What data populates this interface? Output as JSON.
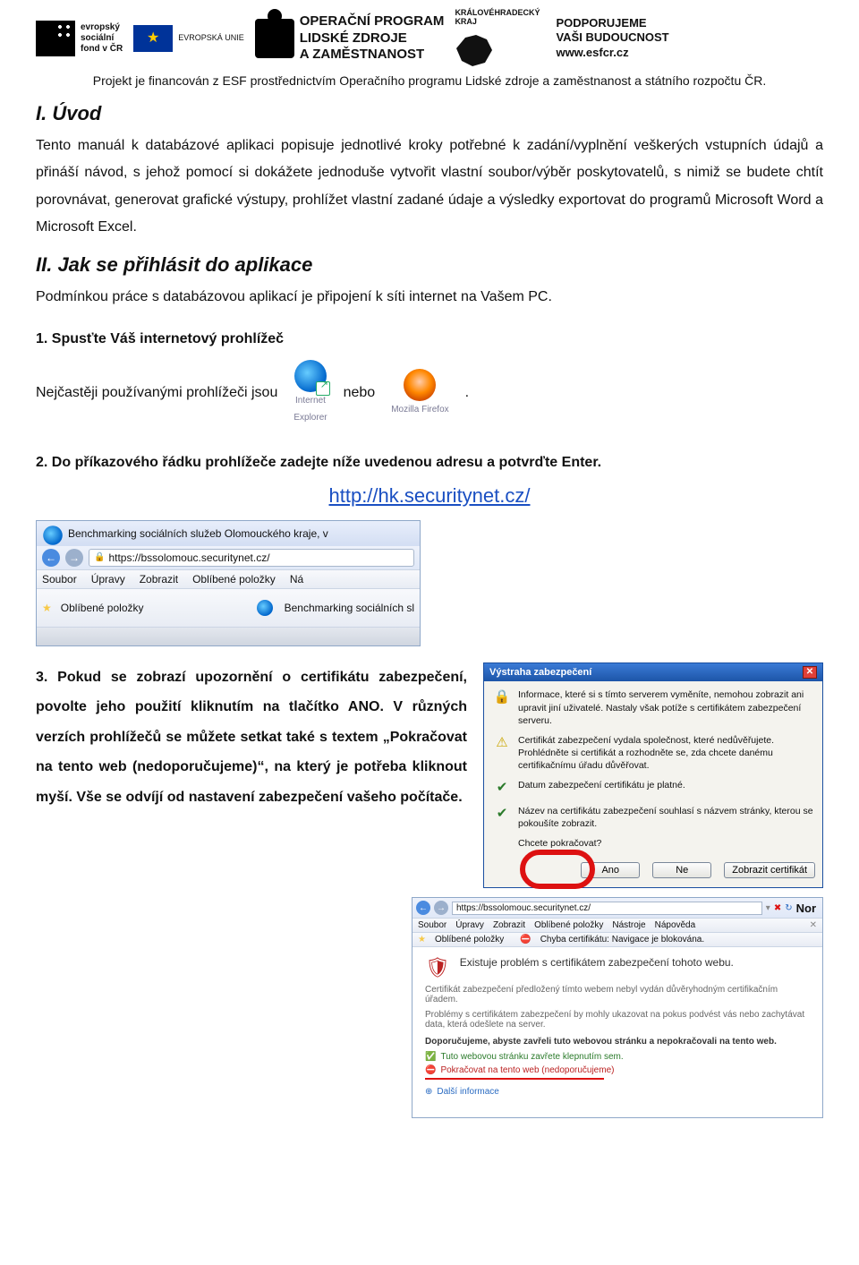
{
  "header": {
    "esf_label_lines": "evropský\nsociální\nfond v ČR",
    "eu_label": "EVROPSKÁ UNIE",
    "op_lines": "OPERAČNÍ PROGRAM\nLIDSKÉ ZDROJE\nA ZAMĚSTNANOST",
    "region_lines": "KRÁLOVÉHRADECKÝ\nKRAJ",
    "support_lines": "PODPORUJEME\nVAŠI BUDOUCNOST",
    "support_url": "www.esfcr.cz",
    "funding_line": "Projekt je financován z ESF prostřednictvím Operačního programu Lidské zdroje a zaměstnanost a státního rozpočtu ČR."
  },
  "sections": {
    "s1_title": "I. Úvod",
    "s1_para": "Tento manuál k databázové aplikaci popisuje jednotlivé kroky potřebné k zadání/vyplnění veškerých vstupních údajů a přináší návod, s jehož pomocí si dokážete jednoduše vytvořit vlastní soubor/výběr poskytovatelů, s nimiž se budete chtít porovnávat, generovat grafické výstupy, prohlížet vlastní zadané údaje a výsledky exportovat do programů Microsoft Word a Microsoft Excel.",
    "s2_title": "II. Jak se přihlásit do aplikace",
    "s2_para": "Podmínkou práce s databázovou aplikací je připojení k síti internet na Vašem PC.",
    "step1_title": "1. Spusťte Váš internetový prohlížeč",
    "step1_line_a": "Nejčastěji používanými prohlížeči jsou",
    "step1_line_b": "nebo",
    "step1_line_c": ".",
    "ie_label": "Internet\nExplorer",
    "ff_label": "Mozilla Firefox",
    "step2_title": "2. Do příkazového řádku prohlížeče zadejte níže uvedenou adresu a potvrďte Enter.",
    "step2_url": "http://hk.securitynet.cz/",
    "step3_para": "3. Pokud se zobrazí upozornění o certifikátu zabezpečení, povolte jeho použití kliknutím na tlačítko ANO. V různých verzích prohlížečů se můžete setkat také s textem „Pokračovat na tento web (nedoporučujeme)“, na který je potřeba kliknout myší. Vše se odvíjí od nastavení zabezpečení vašeho počítače."
  },
  "browser1": {
    "title": "Benchmarking sociálních služeb Olomouckého kraje, v",
    "address": "https://bssolomouc.securitynet.cz/",
    "menu": [
      "Soubor",
      "Úpravy",
      "Zobrazit",
      "Oblíbené položky",
      "Ná"
    ],
    "fav_label": "Oblíbené položky",
    "tab_label": "Benchmarking sociálních sl"
  },
  "dialog": {
    "title": "Výstraha zabezpečení",
    "row1": "Informace, které si s tímto serverem vyměníte, nemohou zobrazit ani upravit jiní uživatelé. Nastaly však potíže s certifikátem zabezpečení serveru.",
    "row2": "Certifikát zabezpečení vydala společnost, které nedůvěřujete. Prohlédněte si certifikát a rozhodněte se, zda chcete danému certifikačnímu úřadu důvěřovat.",
    "row3": "Datum zabezpečení certifikátu je platné.",
    "row4": "Název na certifikátu zabezpečení souhlasí s názvem stránky, kterou se pokoušíte zobrazit.",
    "question": "Chcete pokračovat?",
    "btn_yes": "Ano",
    "btn_no": "Ne",
    "btn_cert": "Zobrazit certifikát"
  },
  "ie_cert": {
    "address": "https://bssolomouc.securitynet.cz/",
    "brand": "Nor",
    "menu": [
      "Soubor",
      "Úpravy",
      "Zobrazit",
      "Oblíbené položky",
      "Nástroje",
      "Nápověda"
    ],
    "fav_label": "Oblíbené položky",
    "tab_label": "Chyba certifikátu: Navigace je blokována.",
    "heading": "Existuje problém s certifikátem zabezpečení tohoto webu.",
    "p1": "Certifikát zabezpečení předložený tímto webem nebyl vydán důvěryhodným certifikačním úřadem.",
    "p2": "Problémy s certifikátem zabezpečení by mohly ukazovat na pokus podvést vás nebo zachytávat data, která odešlete na server.",
    "rec": "Doporučujeme, abyste zavřeli tuto webovou stránku a nepokračovali na tento web.",
    "link_close": "Tuto webovou stránku zavřete klepnutím sem.",
    "link_continue": "Pokračovat na tento web (nedoporučujeme)",
    "link_more": "Další informace"
  }
}
